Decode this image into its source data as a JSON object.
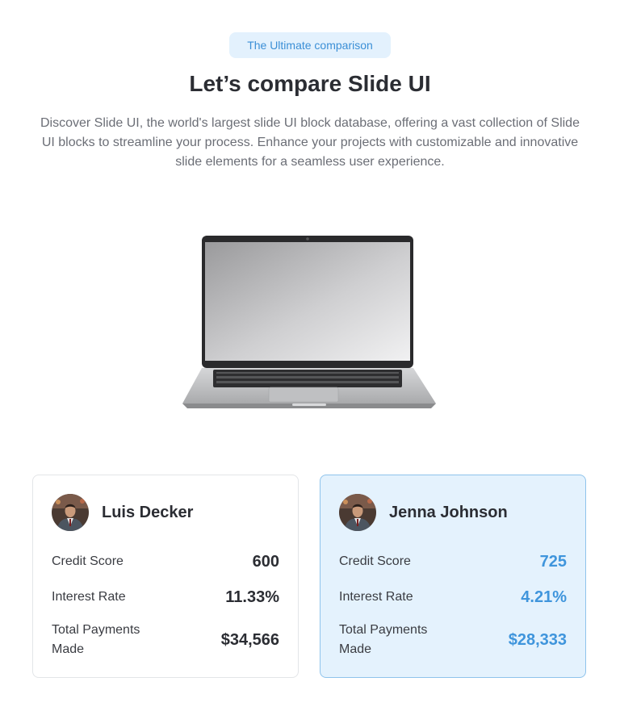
{
  "badge": "The Ultimate comparison",
  "title": "Let’s compare Slide UI",
  "description": "Discover Slide UI, the world's largest slide UI block database, offering a vast collection of Slide UI blocks to streamline your process. Enhance your projects with customizable and innovative slide elements for a seamless user experience.",
  "image": {
    "icon": "laptop-image"
  },
  "cards": [
    {
      "name": "Luis Decker",
      "highlighted": false,
      "rows": [
        {
          "label": "Credit Score",
          "value": "600"
        },
        {
          "label": "Interest Rate",
          "value": "11.33%"
        },
        {
          "label": "Total Payments Made",
          "value": "$34,566"
        }
      ]
    },
    {
      "name": "Jenna Johnson",
      "highlighted": true,
      "rows": [
        {
          "label": "Credit Score",
          "value": "725"
        },
        {
          "label": "Interest Rate",
          "value": "4.21%"
        },
        {
          "label": "Total Payments Made",
          "value": "$28,333"
        }
      ]
    }
  ],
  "colors": {
    "accent": "#3f95dc",
    "badge_bg": "#e3f1fd",
    "highlight_bg": "#e4f2fd",
    "highlight_border": "#8fc3ec"
  }
}
